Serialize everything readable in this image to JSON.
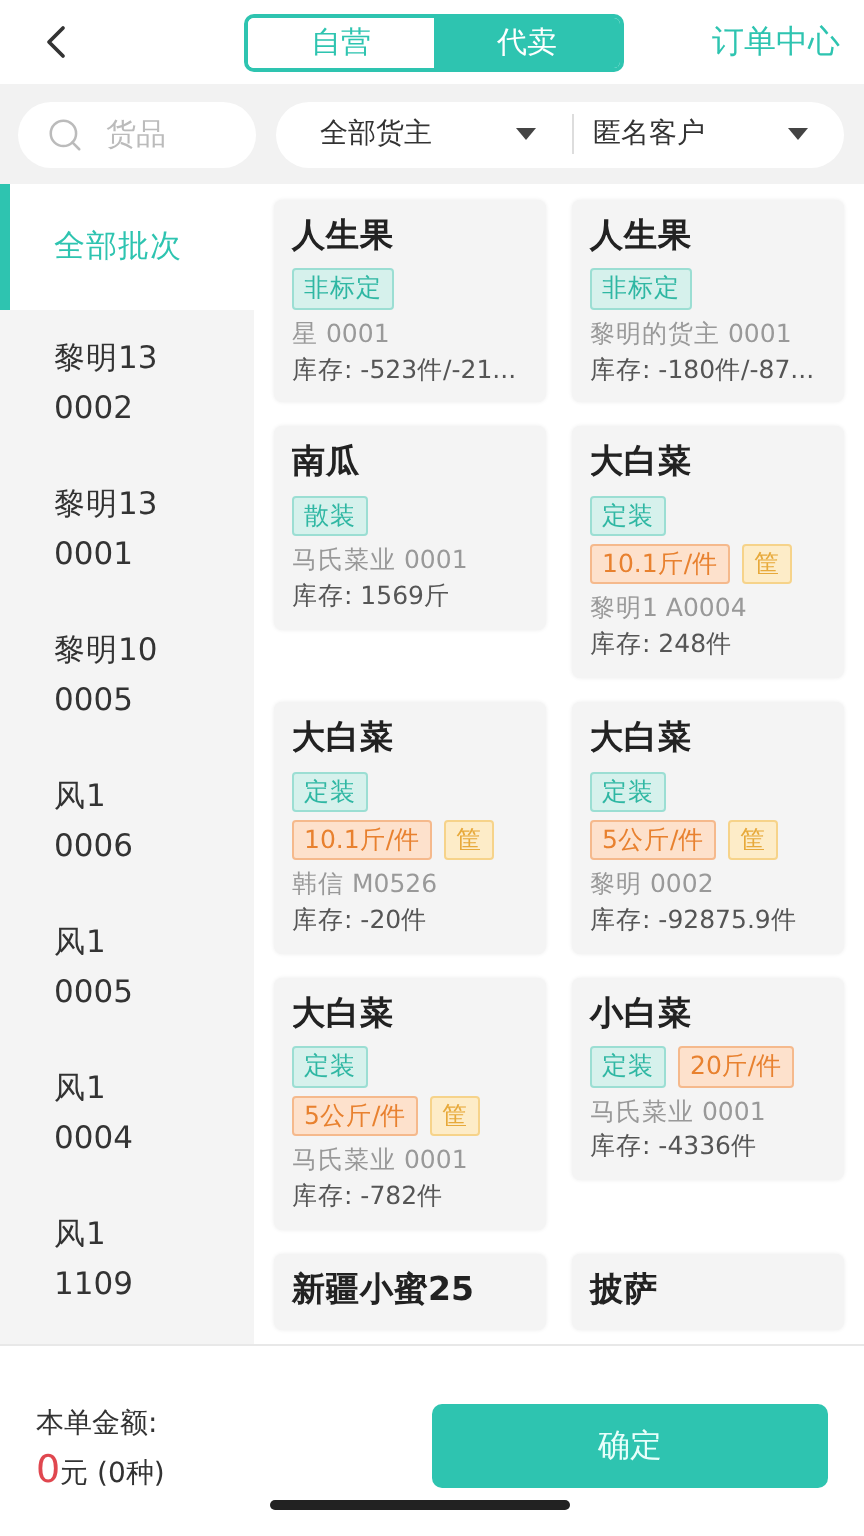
{
  "segments": [
    {
      "label": "自营",
      "selected": false
    },
    {
      "label": "代卖",
      "selected": true
    }
  ],
  "order_center": "订单中心",
  "search": {
    "placeholder": "货品"
  },
  "filters": [
    {
      "value": "全部货主"
    },
    {
      "value": "匿名客户"
    }
  ],
  "batches": [
    {
      "label": "全部批次",
      "selected": true
    },
    {
      "label": "黎明13 0002",
      "selected": false
    },
    {
      "label": "黎明13 0001",
      "selected": false
    },
    {
      "label": "黎明10 0005",
      "selected": false
    },
    {
      "label": "风1 0006",
      "selected": false
    },
    {
      "label": "风1 0005",
      "selected": false
    },
    {
      "label": "风1 0004",
      "selected": false
    },
    {
      "label": "风1 1109",
      "selected": false
    }
  ],
  "products": [
    {
      "name": "人生果",
      "tags": [
        {
          "kind": "grade",
          "text": "非标定"
        }
      ],
      "owner": "星 0001",
      "stock": "库存: -523件/-21..."
    },
    {
      "name": "人生果",
      "tags": [
        {
          "kind": "grade",
          "text": "非标定"
        }
      ],
      "owner": "黎明的货主 0001",
      "stock": "库存: -180件/-87..."
    },
    {
      "name": "南瓜",
      "tags": [
        {
          "kind": "grade",
          "text": "散装"
        }
      ],
      "owner": "马氏菜业 0001",
      "stock": "库存: 1569斤"
    },
    {
      "name": "大白菜",
      "tags": [
        {
          "kind": "grade",
          "text": "定装"
        },
        {
          "kind": "spec",
          "text": "10.1斤/件"
        },
        {
          "kind": "pack",
          "text": "筐"
        }
      ],
      "owner": "黎明1 A0004",
      "stock": "库存: 248件"
    },
    {
      "name": "大白菜",
      "tags": [
        {
          "kind": "grade",
          "text": "定装"
        },
        {
          "kind": "spec",
          "text": "10.1斤/件"
        },
        {
          "kind": "pack",
          "text": "筐"
        }
      ],
      "owner": "韩信 M0526",
      "stock": "库存: -20件"
    },
    {
      "name": "大白菜",
      "tags": [
        {
          "kind": "grade",
          "text": "定装"
        },
        {
          "kind": "spec",
          "text": "5公斤/件"
        },
        {
          "kind": "pack",
          "text": "筐"
        }
      ],
      "owner": "黎明 0002",
      "stock": "库存: -92875.9件"
    },
    {
      "name": "大白菜",
      "tags": [
        {
          "kind": "grade",
          "text": "定装"
        },
        {
          "kind": "spec",
          "text": "5公斤/件"
        },
        {
          "kind": "pack",
          "text": "筐"
        }
      ],
      "owner": "马氏菜业 0001",
      "stock": "库存: -782件"
    },
    {
      "name": "小白菜",
      "tags": [
        {
          "kind": "grade",
          "text": "定装"
        },
        {
          "kind": "spec",
          "text": "20斤/件"
        }
      ],
      "owner": "马氏菜业 0001",
      "stock": "库存: -4336件"
    },
    {
      "name": "新疆小蜜25"
    },
    {
      "name": "披萨"
    }
  ],
  "footer": {
    "amount_label": "本单金额:",
    "amount": "0",
    "amount_unit": "元 (0种)",
    "confirm": "确定"
  }
}
